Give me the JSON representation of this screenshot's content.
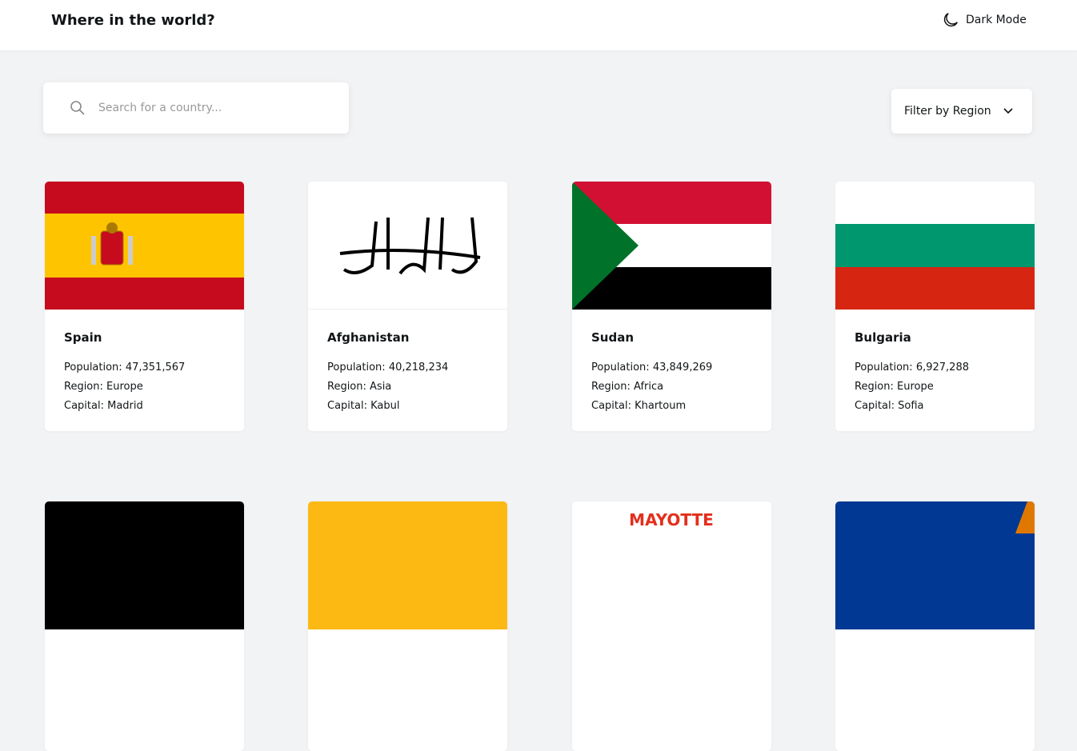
{
  "header": {
    "title": "Where in the world?",
    "dark_mode_label": "Dark Mode",
    "dark_mode_icon": "moon-icon"
  },
  "search": {
    "placeholder": "Search for a country...",
    "value": "",
    "icon": "search-icon"
  },
  "filter": {
    "label": "Filter by Region",
    "icon": "chevron-down-icon"
  },
  "labels": {
    "population": "Population:",
    "region": "Region:",
    "capital": "Capital:"
  },
  "countries": [
    {
      "name": "Spain",
      "population": "47,351,567",
      "region": "Europe",
      "capital": "Madrid"
    },
    {
      "name": "Afghanistan",
      "population": "40,218,234",
      "region": "Asia",
      "capital": "Kabul"
    },
    {
      "name": "Sudan",
      "population": "43,849,269",
      "region": "Africa",
      "capital": "Khartoum"
    },
    {
      "name": "Bulgaria",
      "population": "6,927,288",
      "region": "Europe",
      "capital": "Sofia"
    }
  ],
  "flag_logos": {
    "mayotte": "MAYOTTE"
  }
}
